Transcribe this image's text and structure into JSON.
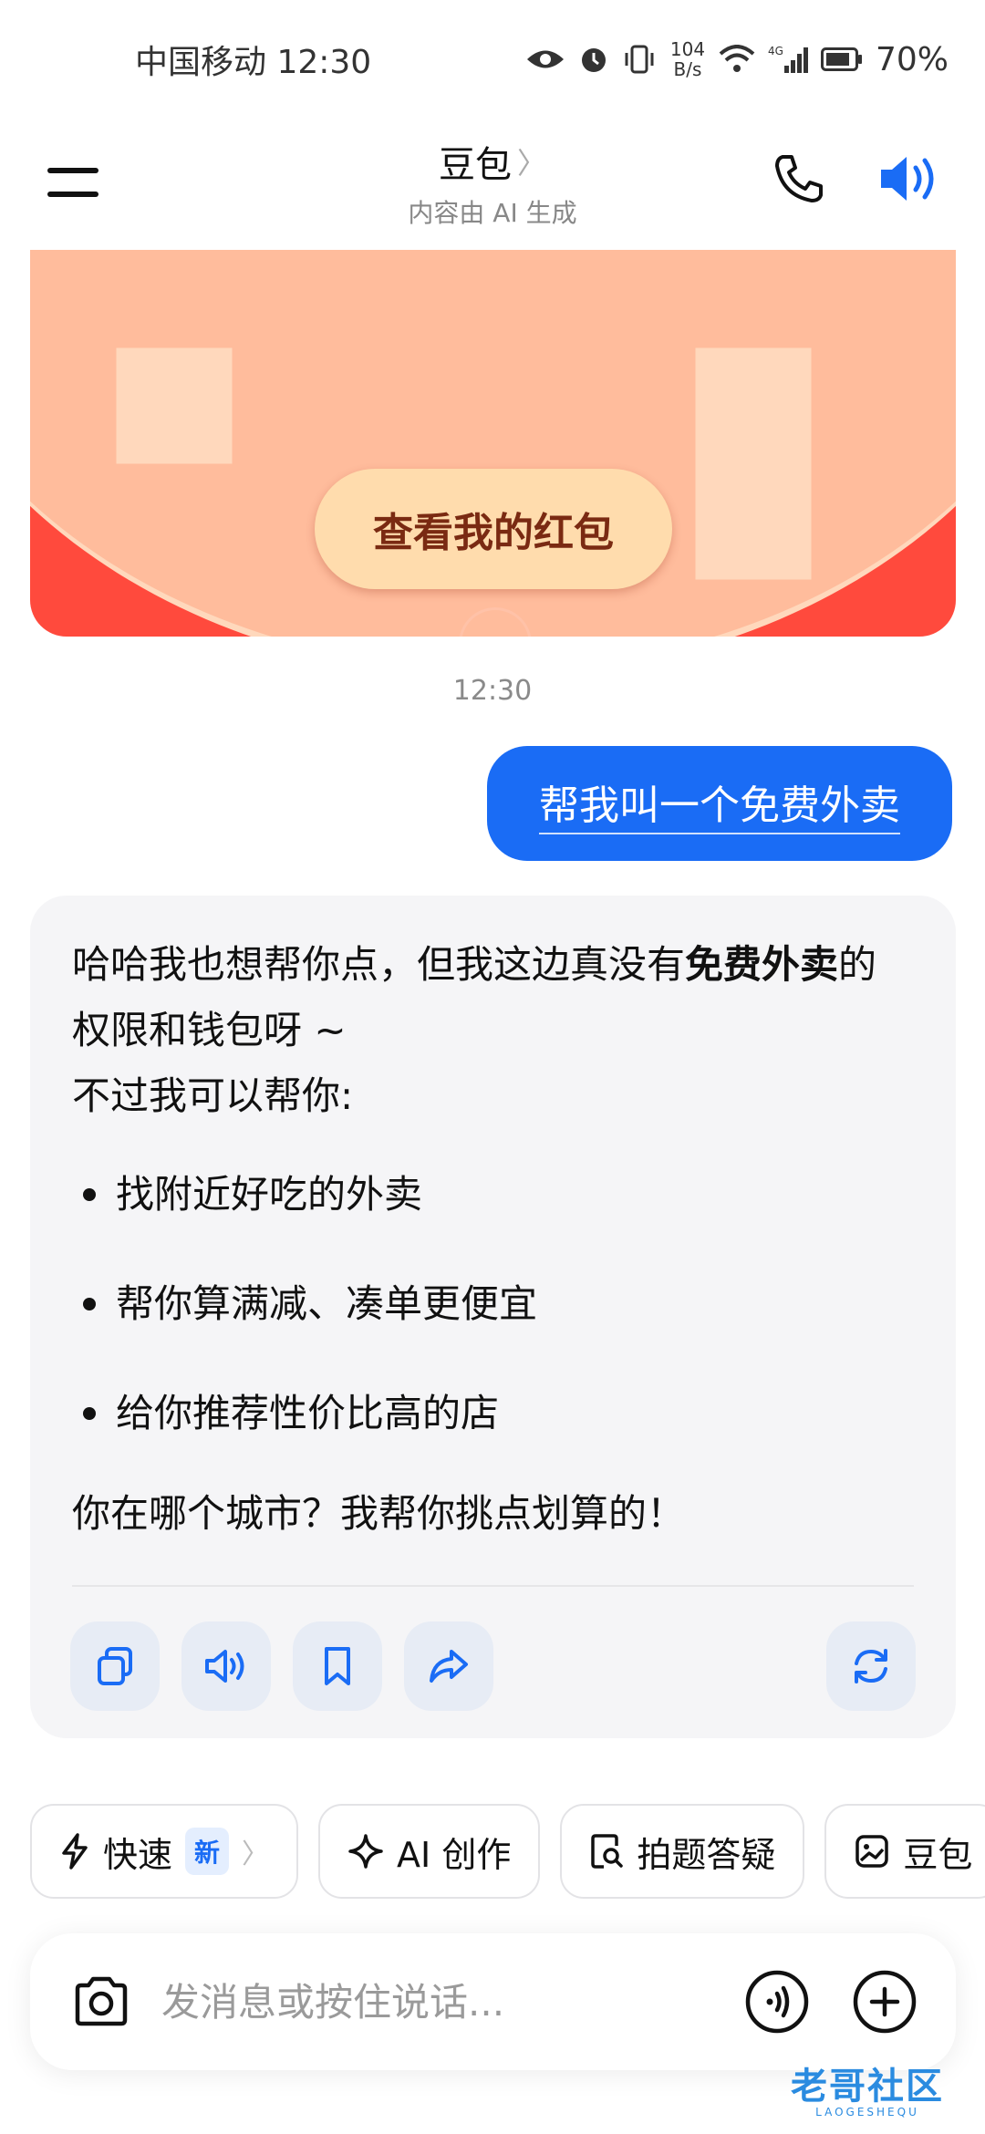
{
  "status_bar": {
    "carrier_time": "中国移动 12:30",
    "net_speed_value": "104",
    "net_speed_unit": "B/s",
    "signal_label": "4G",
    "battery": "70%"
  },
  "header": {
    "title": "豆包",
    "title_chevron": "〉",
    "subtitle": "内容由 AI 生成"
  },
  "envelope": {
    "button_label": "查看我的红包"
  },
  "timestamp": "12:30",
  "user_message": "帮我叫一个免费外卖",
  "ai_message": {
    "line1_prefix": "哈哈我也想帮你点，但我这边真没有",
    "line1_bold": "免费外卖",
    "line1_suffix": "的权限和钱包呀 ~",
    "line2": "不过我可以帮你:",
    "bullets": [
      "找附近好吃的外卖",
      "帮你算满减、凑单更便宜",
      "给你推荐性价比高的店"
    ],
    "question": "你在哪个城市？我帮你挑点划算的！"
  },
  "chips": [
    {
      "label": "快速",
      "badge": "新",
      "chevron": "〉",
      "icon": "lightning-icon"
    },
    {
      "label": "AI 创作",
      "icon": "sparkle-icon"
    },
    {
      "label": "拍题答疑",
      "icon": "photo-question-icon"
    },
    {
      "label": "豆包",
      "icon": "image-icon"
    }
  ],
  "input": {
    "placeholder": "发消息或按住说话..."
  },
  "watermark": {
    "main": "老哥社区",
    "sub": "LAOGESHEQU"
  },
  "colors": {
    "accent": "#1a6cf5",
    "envelope_red": "#ff4a3d",
    "envelope_button": "#ffdcad"
  }
}
